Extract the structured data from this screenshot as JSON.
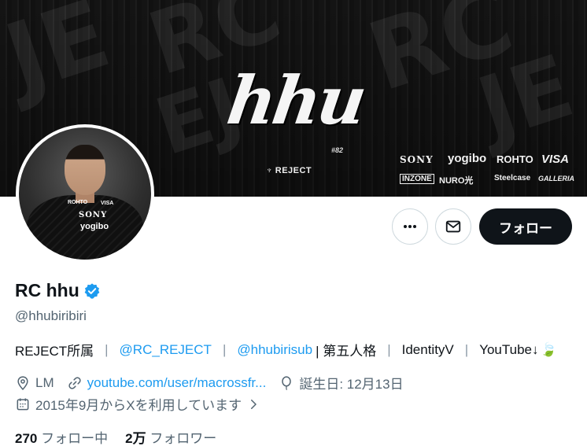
{
  "banner": {
    "title": "hhu",
    "number": "#82",
    "team": "REJECT",
    "sponsors_row1": [
      "SONY",
      "yogibo",
      "ROHTO",
      "VISA"
    ],
    "sponsors_row2": [
      "INZONE",
      "NURO光",
      "Steelcase",
      "GALLERIA"
    ]
  },
  "avatar": {
    "shirt_sponsors": [
      "ROHTO",
      "VISA",
      "SONY",
      "yogibo"
    ]
  },
  "actions": {
    "follow_label": "フォロー"
  },
  "profile": {
    "display_name": "RC hhu",
    "handle": "@hhubiribiri",
    "bio": {
      "part1": "REJECT所属",
      "mention1": "@RC_REJECT",
      "mention2": "@hhubirisub",
      "part2": "| 第五人格",
      "part3": "IdentityV",
      "part4": "YouTube↓",
      "emoji": "🍃"
    },
    "location": "LM",
    "website": "youtube.com/user/macrossfr...",
    "birthday": "誕生日: 12月13日",
    "joined": "2015年9月からXを利用しています"
  },
  "stats": {
    "following_count": "270",
    "following_label": "フォロー中",
    "followers_count": "2万",
    "followers_label": "フォロワー"
  },
  "colors": {
    "accent": "#1d9bf0",
    "text": "#0f1419",
    "secondary": "#536471",
    "button_dark": "#0f1419"
  }
}
